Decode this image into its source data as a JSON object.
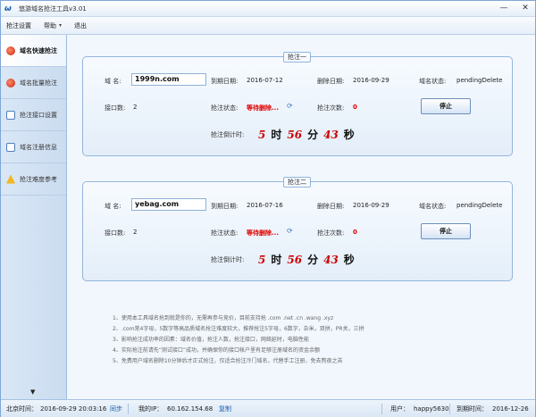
{
  "window": {
    "title": "悠游域名抢注工具v3.01",
    "minimize": "—",
    "close": "✕"
  },
  "menu": {
    "settings": "抢注设置",
    "help": "帮助",
    "help_arrow": "▾",
    "exit": "退出"
  },
  "sidebar": {
    "items": [
      {
        "label": "域名快速抢注",
        "icon": "red-ball-icon"
      },
      {
        "label": "域名批量抢注",
        "icon": "red-ball-icon"
      },
      {
        "label": "抢注接口设置",
        "icon": "document-icon"
      },
      {
        "label": "域名注册信息",
        "icon": "document-icon"
      },
      {
        "label": "抢注难度参考",
        "icon": "warning-icon"
      }
    ],
    "scroll_arrow": "▼"
  },
  "panels": [
    {
      "legend": "抢注一",
      "domain_label": "域  名:",
      "domain": "1999n.com",
      "expire_label": "到期日期:",
      "expire_date": "2016-07-12",
      "delete_label": "删除日期:",
      "delete_date": "2016-09-29",
      "domain_status_label": "域名状态:",
      "domain_status": "pendingDelete",
      "ports_label": "接口数:",
      "ports": "2",
      "grab_status_label": "抢注状态:",
      "grab_status": "等待删除...",
      "attempts_label": "抢注次数:",
      "attempts": "0",
      "stop_label": "停止",
      "countdown_label": "抢注倒计时:",
      "hours": "5",
      "hours_unit": "时",
      "minutes": "56",
      "minutes_unit": "分",
      "seconds": "43",
      "seconds_unit": "秒"
    },
    {
      "legend": "抢注二",
      "domain_label": "域  名:",
      "domain": "yebag.com",
      "expire_label": "到期日期:",
      "expire_date": "2016-07-16",
      "delete_label": "删除日期:",
      "delete_date": "2016-09-29",
      "domain_status_label": "域名状态:",
      "domain_status": "pendingDelete",
      "ports_label": "接口数:",
      "ports": "2",
      "grab_status_label": "抢注状态:",
      "grab_status": "等待删除...",
      "attempts_label": "抢注次数:",
      "attempts": "0",
      "stop_label": "停止",
      "countdown_label": "抢注倒计时:",
      "hours": "5",
      "hours_unit": "时",
      "minutes": "56",
      "minutes_unit": "分",
      "seconds": "43",
      "seconds_unit": "秒"
    }
  ],
  "notes": [
    "1、使用本工具域名抢到就是你的，无需再参与竞价，目前支持抢 .com .net .cn .wang .xyz",
    "2、.com常4字母，5数字等高品质域名抢注难度较大，推荐抢注5字母，6数字，杂米，双拼，PR关，三拼",
    "3、影响抢注成功率的因素：域名价值，抢注人数，抢注接口，网络延时，电脑性能",
    "4、实际抢注前请先“测试接口”成功，并确保你的接口帐户里有足够注册域名的资金余额",
    "5、免费用户域名删除10分钟后才正式抢注，仅适合抢注冷门域名，代替手工注册，免去熬夜之苦"
  ],
  "statusbar": {
    "time_label": "北京时间：",
    "time": "2016-09-29 20:03:16",
    "sync": "同步",
    "ip_label": "我的IP：",
    "ip": "60.162.154.68",
    "copy": "复制",
    "user_label": "用户：",
    "user": "happy5630",
    "expire_label": "到期时间：",
    "expire": "2016-12-26"
  },
  "colors": {
    "status_red": "#e00000",
    "accent_blue": "#1b5fb0"
  }
}
